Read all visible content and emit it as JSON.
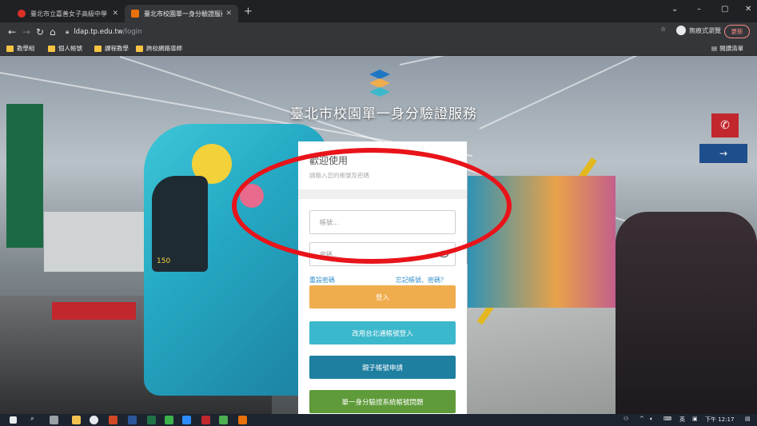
{
  "browser": {
    "tabs": [
      {
        "title": "臺北市立嘉善女子高級中學 - 副...",
        "favicon_color": "#d93025",
        "active": false
      },
      {
        "title": "臺北市校園單一身分驗證服務",
        "favicon_color": "#e8710a",
        "active": true
      }
    ],
    "new_tab_glyph": "+",
    "window_controls": [
      "⌄",
      "–",
      "▢",
      "✕"
    ],
    "url_host": "ldap.tp.edu.tw",
    "url_path": "/login",
    "profile_label": "無痕式瀏覽",
    "update_label": "更新",
    "bookmarks": [
      "教學組",
      "個人帳號",
      "課程教學",
      "跨校網路導師"
    ],
    "reading_list_label": "閱讀清單"
  },
  "page": {
    "title": "臺北市校園單一身分驗證服務",
    "logo_colors": [
      "#1f77c4",
      "#f0ad4e",
      "#3cb8cc"
    ],
    "card": {
      "welcome": "歡迎使用",
      "subnote": "請輸入您的帳號及密碼"
    },
    "username": {
      "placeholder": "帳號..."
    },
    "password": {
      "placeholder": "密碼..."
    },
    "reset_password_link": "重設密碼",
    "forgot_link": "忘記帳號、密碼？",
    "buttons": {
      "login": "登入",
      "taipei_pass": "改用台北通帳號登入",
      "parent_apply": "親子帳號申請",
      "faq": "單一身分驗證系統帳號問題"
    },
    "train_number": "150",
    "annotation_color": "#e8141a"
  },
  "taskbar": {
    "time": "下午 12:17",
    "ime": "英"
  }
}
